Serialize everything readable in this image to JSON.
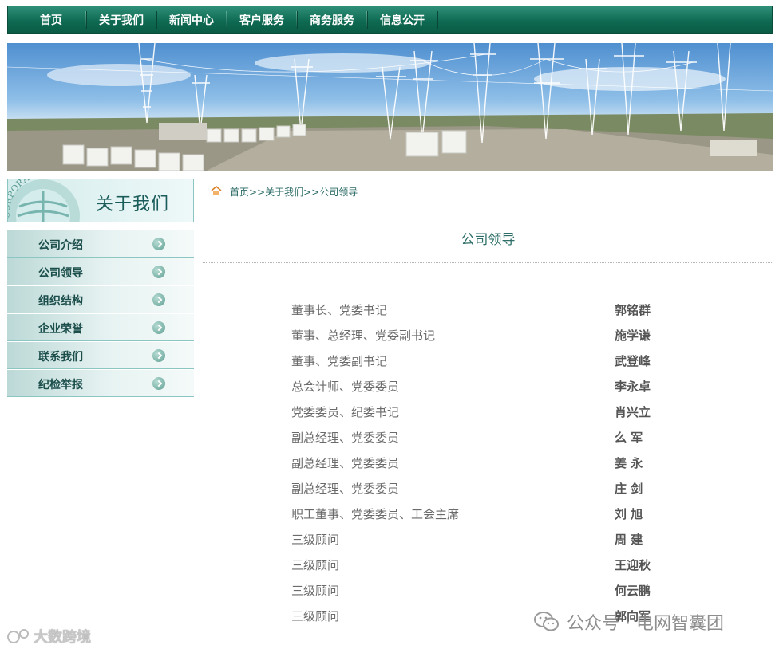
{
  "nav": [
    "首页",
    "关于我们",
    "新闻中心",
    "客户服务",
    "商务服务",
    "信息公开"
  ],
  "sidebar": {
    "logo_text": "CORPORATION OF",
    "title": "关于我们",
    "items": [
      "公司介绍",
      "公司领导",
      "组织结构",
      "企业荣誉",
      "联系我们",
      "纪检举报"
    ]
  },
  "breadcrumb": {
    "home": "首页",
    "sep1": ">>",
    "about": "关于我们",
    "sep2": ">>",
    "current": "公司领导"
  },
  "page": {
    "title": "公司领导"
  },
  "leaders": [
    {
      "position": "董事长、党委书记",
      "name": "郭铭群"
    },
    {
      "position": "董事、总经理、党委副书记",
      "name": "施学谦"
    },
    {
      "position": "董事、党委副书记",
      "name": "武登峰"
    },
    {
      "position": "总会计师、党委委员",
      "name": "李永卓"
    },
    {
      "position": "党委委员、纪委书记",
      "name": "肖兴立"
    },
    {
      "position": "副总经理、党委委员",
      "name": "么  军"
    },
    {
      "position": "副总经理、党委委员",
      "name": "姜  永"
    },
    {
      "position": "副总经理、党委委员",
      "name": "庄  剑"
    },
    {
      "position": "职工董事、党委委员、工会主席",
      "name": "刘  旭"
    },
    {
      "position": "三级顾问",
      "name": "周  建"
    },
    {
      "position": "三级顾问",
      "name": "王迎秋"
    },
    {
      "position": "三级顾问",
      "name": "何云鹏"
    },
    {
      "position": "三级顾问",
      "name": "郭向军"
    }
  ],
  "watermark": {
    "left": "大数跨境",
    "right": "公众号 · 电网智囊团"
  },
  "colors": {
    "nav_green": "#0e6a52",
    "accent_teal": "#2d6f68",
    "divider_teal": "#8cc6c3"
  }
}
